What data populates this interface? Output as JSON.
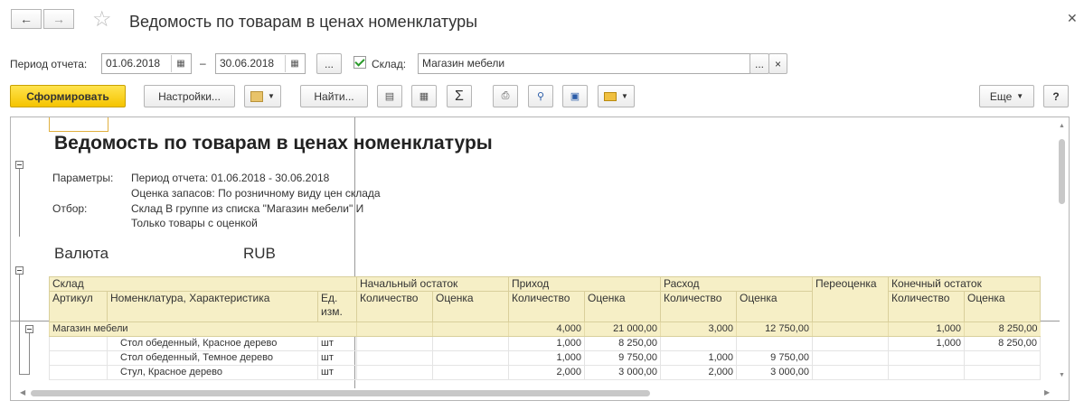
{
  "window": {
    "title": "Ведомость по товарам в ценах номенклатуры",
    "back_icon": "arrow-left-icon",
    "forward_icon": "arrow-right-icon",
    "favorite_icon": "star-icon",
    "close_icon": "close-icon"
  },
  "filters": {
    "period_label": "Период отчета:",
    "date_from": "01.06.2018",
    "date_dash": "–",
    "date_to": "30.06.2018",
    "period_select_label": "...",
    "warehouse_checked": true,
    "warehouse_label": "Склад:",
    "warehouse_value": "Магазин мебели",
    "warehouse_select_label": "...",
    "warehouse_clear_label": "×"
  },
  "toolbar": {
    "generate_label": "Сформировать",
    "settings_label": "Настройки...",
    "find_label": "Найти...",
    "sum_label": "Σ",
    "more_label": "Еще",
    "help_label": "?"
  },
  "report": {
    "title": "Ведомость по товарам в ценах номенклатуры",
    "params_label": "Параметры:",
    "params_line1": "Период отчета: 01.06.2018 - 30.06.2018",
    "params_line2": "Оценка запасов: По розничному виду цен склада",
    "filter_label": "Отбор:",
    "filter_line1": "Склад В группе из списка \"Магазин мебели\" И",
    "filter_line2": "Только товары с оценкой",
    "currency_label": "Валюта",
    "currency_value": "RUB",
    "headers": {
      "warehouse": "Склад",
      "article": "Артикул",
      "nomenclature": "Номенклатура, Характеристика",
      "unit": "Ед. изм.",
      "opening": "Начальный остаток",
      "income": "Приход",
      "expense": "Расход",
      "revaluation": "Переоценка",
      "closing": "Конечный остаток",
      "qty": "Количество",
      "value": "Оценка"
    },
    "group_row": {
      "name": "Магазин мебели",
      "income_qty": "4,000",
      "income_value": "21 000,00",
      "expense_qty": "3,000",
      "expense_value": "12 750,00",
      "closing_qty": "1,000",
      "closing_value": "8 250,00"
    },
    "rows": [
      {
        "name": "Стол обеденный, Красное дерево",
        "unit": "шт",
        "income_qty": "1,000",
        "income_value": "8 250,00",
        "expense_qty": "",
        "expense_value": "",
        "closing_qty": "1,000",
        "closing_value": "8 250,00"
      },
      {
        "name": "Стол обеденный, Темное дерево",
        "unit": "шт",
        "income_qty": "1,000",
        "income_value": "9 750,00",
        "expense_qty": "1,000",
        "expense_value": "9 750,00",
        "closing_qty": "",
        "closing_value": ""
      },
      {
        "name": "Стул, Красное дерево",
        "unit": "шт",
        "income_qty": "2,000",
        "income_value": "3 000,00",
        "expense_qty": "2,000",
        "expense_value": "3 000,00",
        "closing_qty": "",
        "closing_value": ""
      }
    ]
  }
}
